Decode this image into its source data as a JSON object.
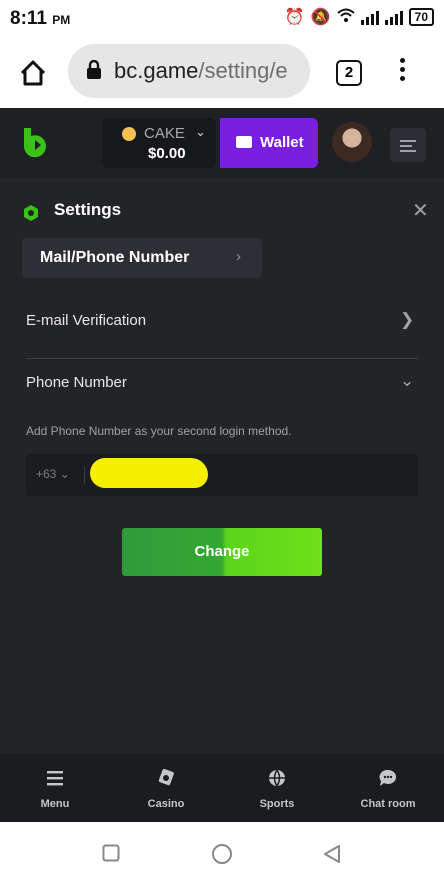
{
  "status_bar": {
    "time": "8:11",
    "ampm": "PM",
    "battery": "70"
  },
  "browser": {
    "url_host": "bc.game",
    "url_path": "/setting/e",
    "tab_count": "2"
  },
  "header": {
    "currency": "CAKE",
    "balance": "$0.00",
    "wallet_label": "Wallet"
  },
  "settings": {
    "title": "Settings",
    "section": "Mail/Phone Number",
    "email_row": "E-mail Verification",
    "phone_row": "Phone Number",
    "hint": "Add Phone Number as your second login method.",
    "country_code": "+63",
    "change_label": "Change"
  },
  "bottom_nav": [
    {
      "label": "Menu",
      "icon": "menu-icon"
    },
    {
      "label": "Casino",
      "icon": "casino-icon"
    },
    {
      "label": "Sports",
      "icon": "sports-icon"
    },
    {
      "label": "Chat room",
      "icon": "chat-icon"
    }
  ],
  "colors": {
    "accent_green": "#3bc117",
    "wallet_purple": "#7a1ee0",
    "bg": "#232428"
  }
}
